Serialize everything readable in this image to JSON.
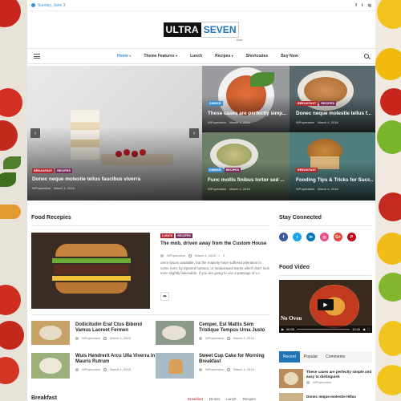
{
  "topbar": {
    "date": "Sunday, June 3",
    "social_icons": [
      "facebook-icon",
      "twitter-icon",
      "instagram-icon"
    ],
    "social_glyphs": [
      "f",
      "t",
      "ig"
    ]
  },
  "logo": {
    "part1": "ULTRA",
    "part2": "SEVEN",
    "tagline": "food"
  },
  "nav": {
    "items": [
      {
        "label": "Home",
        "caret": "▾",
        "active": true
      },
      {
        "label": "Theme Features",
        "caret": "▾"
      },
      {
        "label": "Lunch",
        "caret": ""
      },
      {
        "label": "Recipes",
        "caret": "▾"
      },
      {
        "label": "Shortcodes",
        "caret": ""
      },
      {
        "label": "Buy Now",
        "caret": ""
      }
    ]
  },
  "hero": {
    "main": {
      "badges": [
        "BREAKFAST",
        "RECIPES"
      ],
      "title": "Donec neque molestie tellus faucibus viverra",
      "author": "WPoperation",
      "date": "March 4, 2018"
    },
    "top_mid": {
      "badges": [
        "DINNER"
      ],
      "title": "These cases are perfectly simp...",
      "author": "WPoperation",
      "date": "March 4, 2018"
    },
    "top_right": {
      "badges": [
        "BREAKFAST",
        "RECIPES"
      ],
      "title": "Donec neque molestie tellus f...",
      "author": "WPoperation",
      "date": "March 4, 2018"
    },
    "bottom_mid": {
      "badges": [
        "DINNER",
        "RECIPES"
      ],
      "title": "Func mollis finibus tortor sed ...",
      "author": "WPoperation",
      "date": "March 4, 2018"
    },
    "bottom_right": {
      "badges": [
        "BREAKFAST"
      ],
      "title": "Fooding Tips & Tricks for Succ...",
      "author": "WPoperation",
      "date": "March 4, 2018"
    },
    "prev": "‹",
    "next": "›"
  },
  "food_recipes": {
    "title": "Food Recepies",
    "featured": {
      "badges": [
        "LUNCH",
        "RECIPES"
      ],
      "title": "The mob, driven away from the Custom House",
      "author": "WPoperation",
      "date": "March 4, 2018",
      "comments": "0",
      "excerpt": "orem Ipsum available, but the majority have suffered alteration in some form, by injected humour, or randomised words which don't look even slightly believable. If you are going to use a passage of Lo"
    },
    "list": [
      {
        "title": "Dollicitudin Erat Ctus Bibend Vamus Laoreet Fermen",
        "author": "WPoperation",
        "date": "March 4, 2018"
      },
      {
        "title": "Cemper, Est Mattis Sem Tristique Tempus Urna Justo",
        "author": "WPoperation",
        "date": "March 4, 2018"
      },
      {
        "title": "Wuis Hendrerit Arcu Ulla Viverra In Mauris Rutrum",
        "author": "WPoperation",
        "date": "March 4, 2018"
      },
      {
        "title": "Sweet Cup Cake for Morning Breakfast",
        "author": "WPoperation",
        "date": "March 4, 2018"
      }
    ]
  },
  "breakfast": {
    "title": "Breakfast",
    "tabs": [
      "Breakfast",
      "Dinner",
      "Lunch",
      "Recipes"
    ]
  },
  "sidebar": {
    "stay_connected": "Stay Connected",
    "social": [
      {
        "icon": "facebook-icon",
        "glyph": "f",
        "color": "#3b5998"
      },
      {
        "icon": "twitter-icon",
        "glyph": "t",
        "color": "#1da1f2"
      },
      {
        "icon": "linkedin-icon",
        "glyph": "in",
        "color": "#0077b5"
      },
      {
        "icon": "dribbble-icon",
        "glyph": "◎",
        "color": "#ea4c89"
      },
      {
        "icon": "google-plus-icon",
        "glyph": "G+",
        "color": "#dd4b39"
      },
      {
        "icon": "pinterest-icon",
        "glyph": "P",
        "color": "#bd081c"
      }
    ],
    "food_video": "Food Video",
    "video": {
      "caption": "No Oven",
      "time_current": "00:00",
      "time_total": "10:40"
    },
    "tabs": [
      "Recent",
      "Popular",
      "Comments"
    ],
    "recent": [
      {
        "title": "These cases are perfectly simple and easy to distinguish",
        "author": "WPoperation"
      },
      {
        "title": "Donec neque molestie tellus",
        "author": ""
      }
    ]
  }
}
